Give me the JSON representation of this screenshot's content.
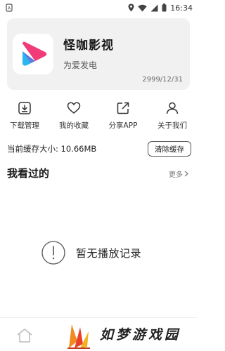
{
  "status_bar": {
    "left_icon": "notification-icon",
    "time": "16:34",
    "icons": [
      "location-icon",
      "wifi-icon",
      "signal-icon",
      "battery-icon"
    ]
  },
  "app_card": {
    "name": "怪咖影视",
    "slogan": "为爱发电",
    "date": "2999/12/31",
    "logo_icon": "app-logo-icon",
    "colors": {
      "logo_pink": "#f23c7a",
      "logo_blue": "#2bb6f0",
      "card_bg": "#f1f1f1"
    }
  },
  "actions": [
    {
      "label": "下载管理",
      "icon": "download-icon"
    },
    {
      "label": "我的收藏",
      "icon": "heart-icon"
    },
    {
      "label": "分享APP",
      "icon": "share-icon"
    },
    {
      "label": "关于我们",
      "icon": "user-icon"
    }
  ],
  "cache": {
    "label": "当前缓存大小: 10.66MB",
    "clear_button": "清除缓存"
  },
  "history": {
    "title": "我看过的",
    "more": "更多",
    "empty_text": "暂无播放记录",
    "empty_icon": "info-circle-icon"
  },
  "bottom_nav": {
    "home_icon": "home-icon"
  },
  "watermark": {
    "text": "如梦游戏园",
    "logo_icon": "watermark-logo-icon"
  }
}
